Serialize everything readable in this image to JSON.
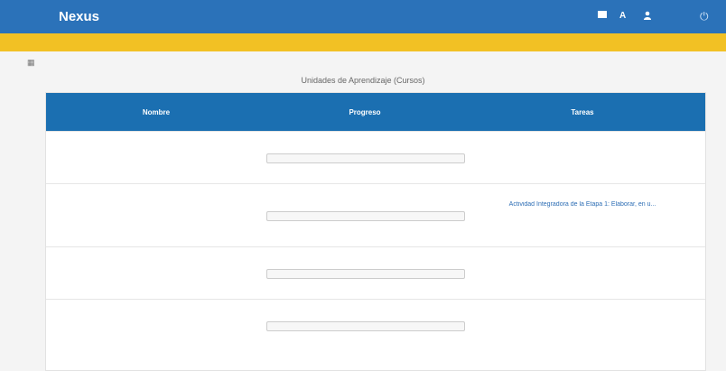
{
  "topbar": {
    "logo": "Nexus",
    "subtitle": "",
    "language": "A",
    "user_name": "",
    "mail_icon": "mail-icon",
    "language_icon": "language-icon",
    "user_icon": "user-icon",
    "power_icon": "power-icon"
  },
  "notice": {
    "text": ""
  },
  "toolbar": {
    "grid_icon": "grid-icon",
    "updated": ""
  },
  "page_title": "Unidades de Aprendizaje (Cursos)",
  "table": {
    "headers": {
      "name": "Nombre",
      "progress": "Progreso",
      "tasks": "Tareas"
    },
    "rows": [
      {
        "name": "",
        "dates": "",
        "progress": 0,
        "progress_label": "",
        "task": "",
        "task_date": ""
      },
      {
        "name": "",
        "dates": "",
        "progress": 0,
        "progress_label": "",
        "task": "Actividad Integradora de la Etapa 1: Elaborar, en u...",
        "task_date": ""
      },
      {
        "name": "",
        "dates": "",
        "progress": 0,
        "progress_label": "",
        "task": "",
        "task_date": ""
      },
      {
        "name": "",
        "dates": "",
        "progress": 0,
        "progress_label": "",
        "task": "",
        "task_date": ""
      }
    ]
  },
  "colors": {
    "topbar": "#2b72b9",
    "notice": "#f2c124",
    "table_header": "#1b6fb1",
    "link": "#2c6db4"
  }
}
